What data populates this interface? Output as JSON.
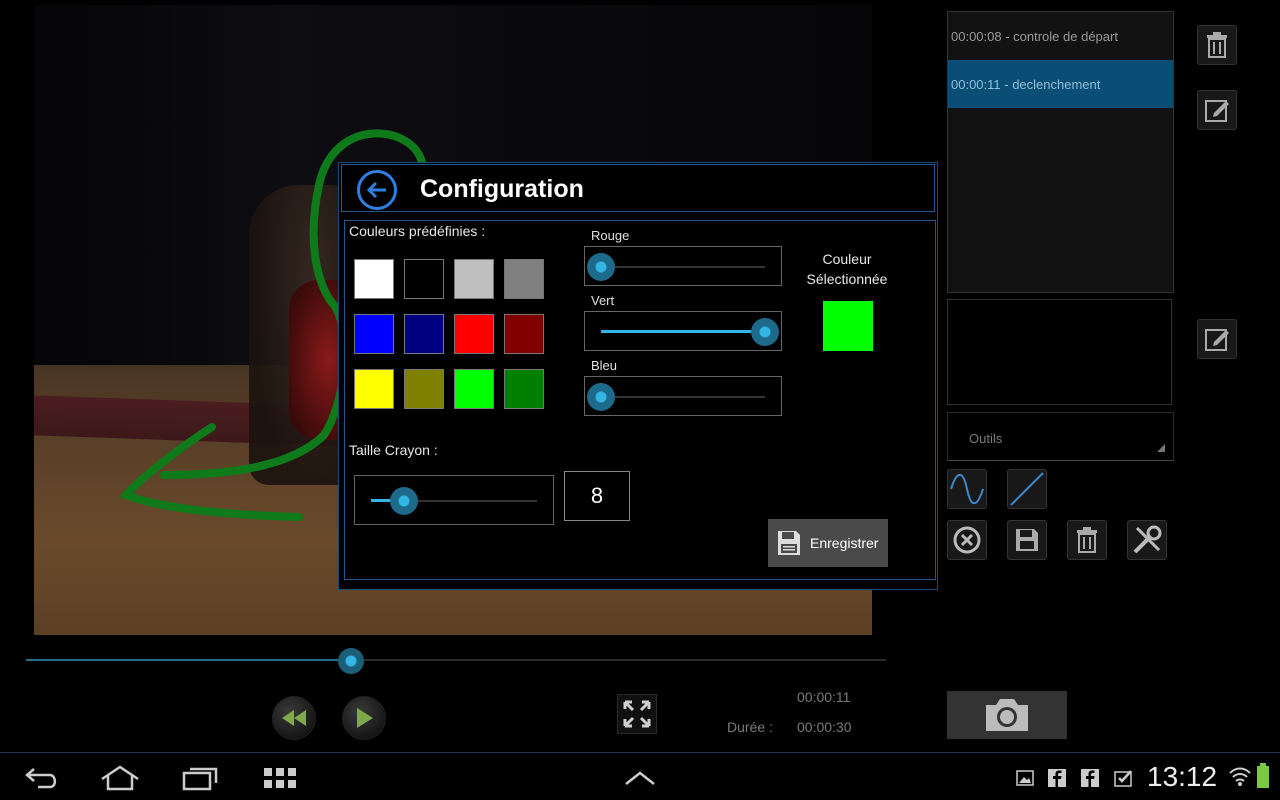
{
  "player": {
    "current_time": "00:00:11",
    "duration_label": "Durée :",
    "duration_value": "00:00:30",
    "progress": 0.378
  },
  "markers": [
    {
      "label": "00:00:08 - controle de départ",
      "selected": false
    },
    {
      "label": "00:00:11 - declenchement",
      "selected": true
    }
  ],
  "tools_select": {
    "label": "Outils"
  },
  "dialog": {
    "title": "Configuration",
    "predefined_colors_label": "Couleurs prédéfinies :",
    "predefined_colors": [
      "#ffffff",
      "#000000",
      "#c0c0c0",
      "#808080",
      "#0000ff",
      "#000080",
      "#ff0000",
      "#800000",
      "#ffff00",
      "#808000",
      "#00ff00",
      "#008000"
    ],
    "sliders": {
      "red": {
        "label": "Rouge",
        "value": 0
      },
      "green": {
        "label": "Vert",
        "value": 255
      },
      "blue": {
        "label": "Bleu",
        "value": 0
      }
    },
    "selected_color_label_line1": "Couleur",
    "selected_color_label_line2": "Sélectionnée",
    "selected_color": "#00ff00",
    "pencil_size_label": "Taille Crayon :",
    "pencil_size": "8",
    "pencil_size_fraction": 0.2,
    "save_label": "Enregistrer"
  },
  "system_bar": {
    "clock": "13:12"
  },
  "colors": {
    "accent": "#33b5e5",
    "dialog_border": "#1e5a95",
    "drawing_stroke": "#0f7a1a"
  }
}
